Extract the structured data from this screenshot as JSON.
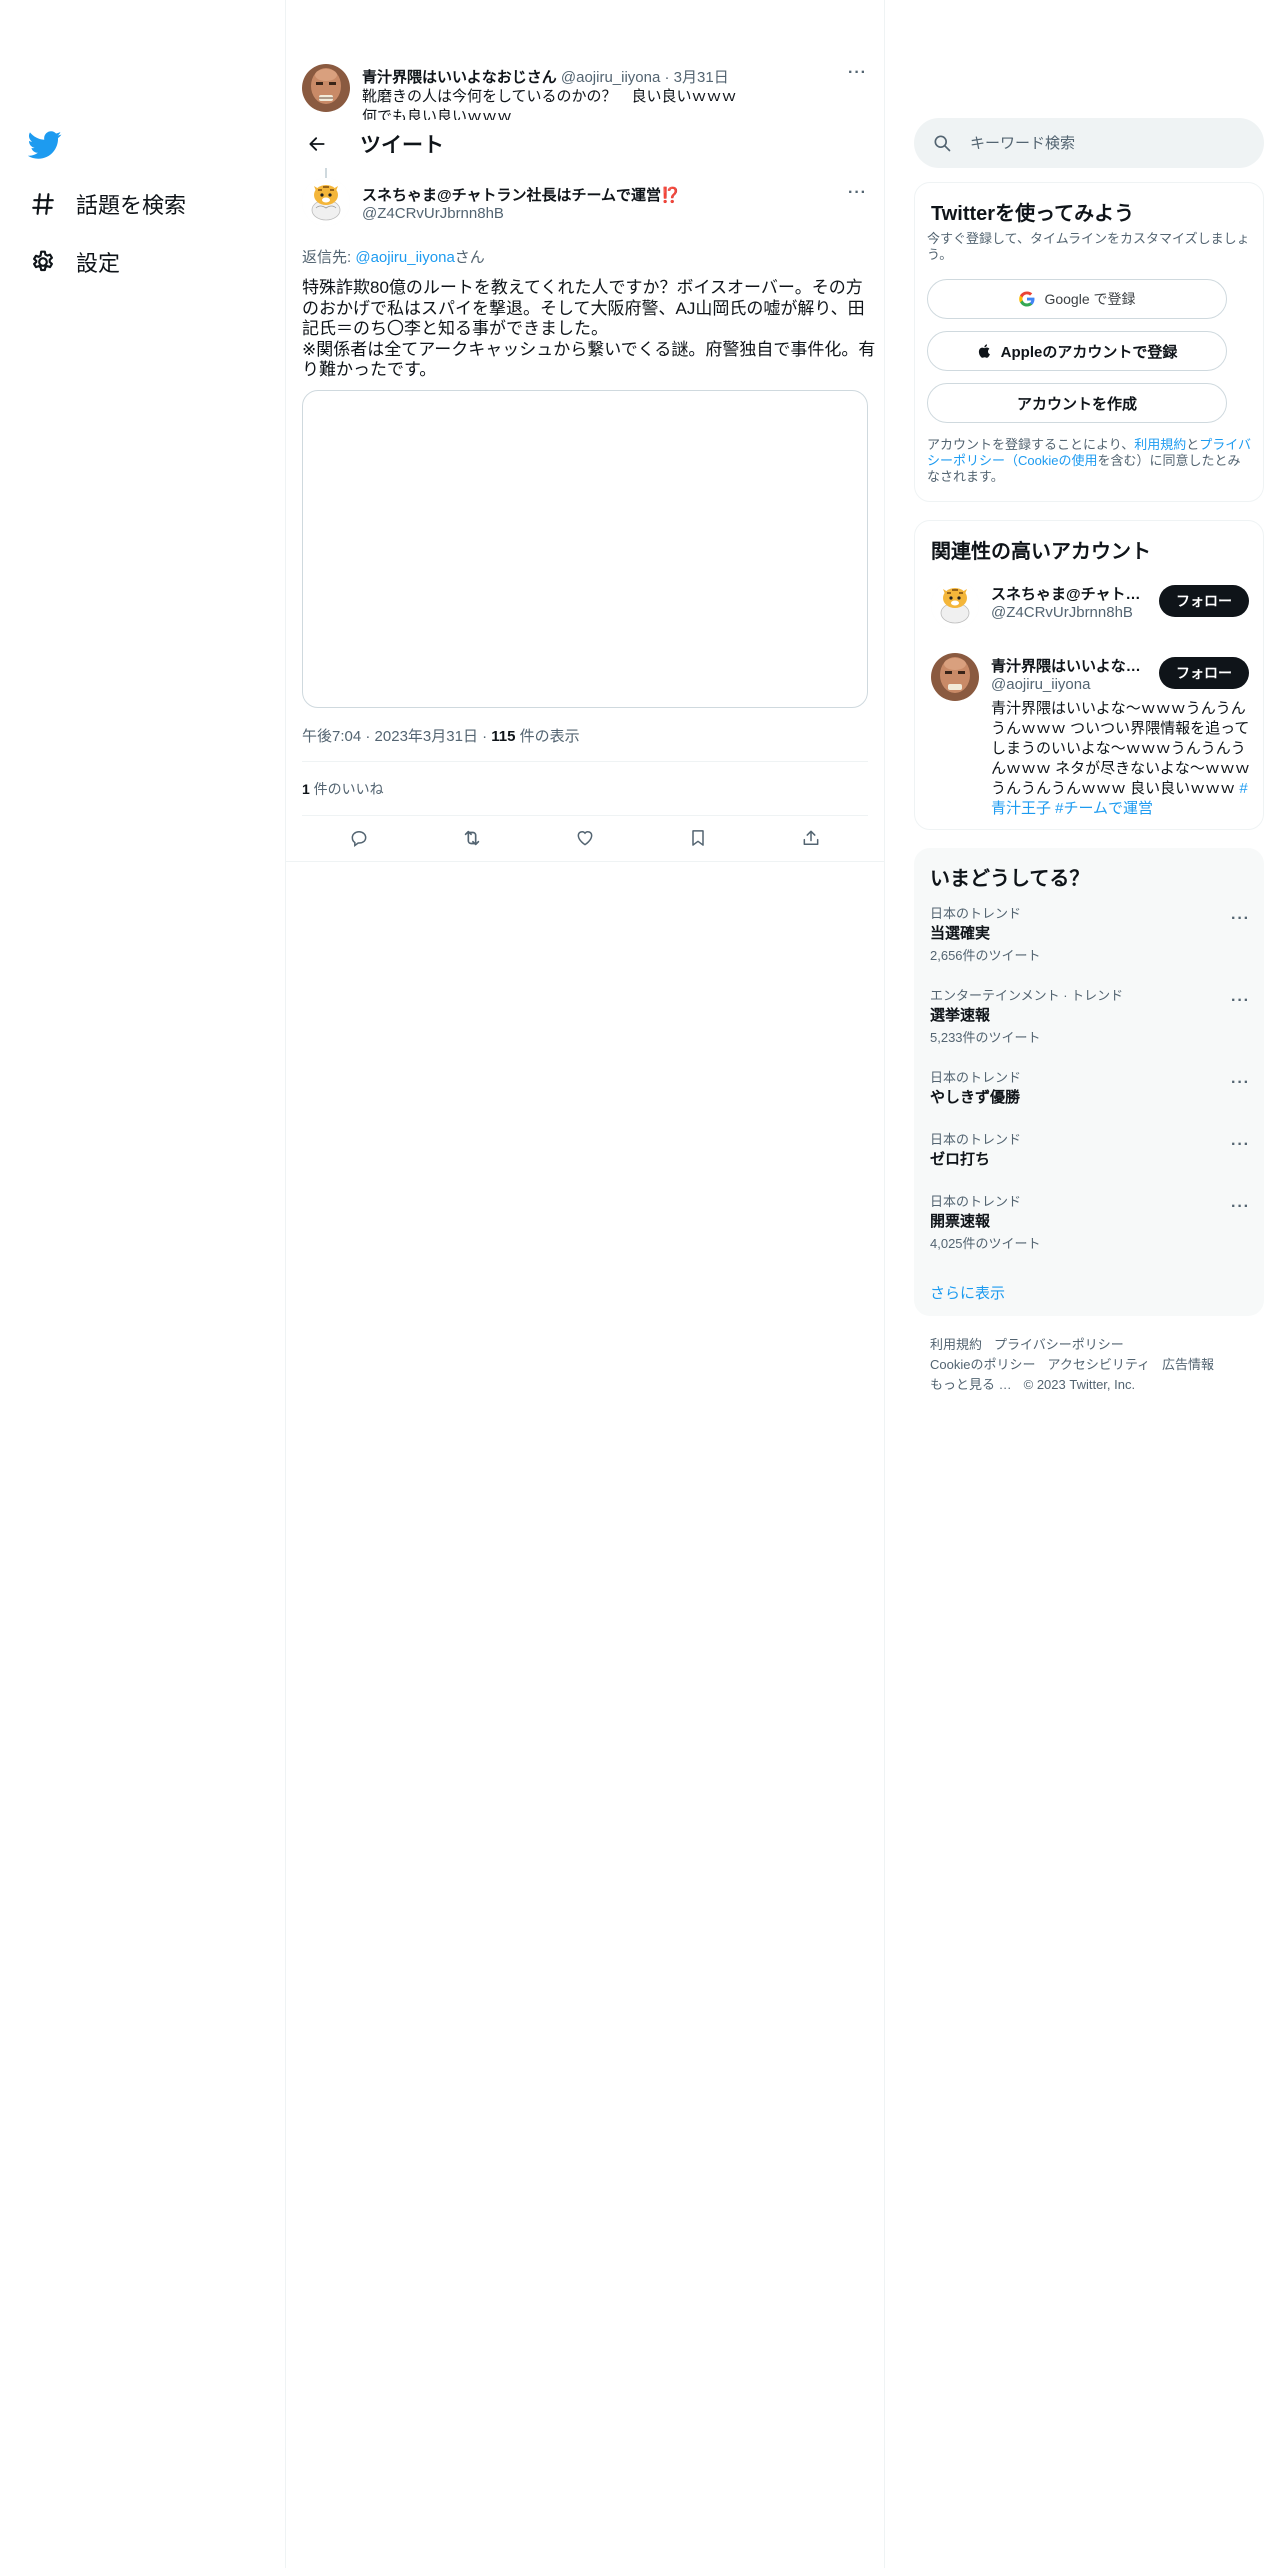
{
  "nav": {
    "logo": "twitter-bird-icon",
    "items": [
      {
        "label": "話題を検索",
        "icon": "hashtag-icon"
      },
      {
        "label": "設定",
        "icon": "gear-icon"
      }
    ]
  },
  "previous_tweet": {
    "name": "青汁界隈はいいよなおじさん",
    "handle": "@aojiru_iiyona",
    "date": "· 3月31日",
    "text": "靴磨きの人は今何をしているのかの？　良い良いｗｗｗ\n何でも良い良いｗｗｗ"
  },
  "header": {
    "title": "ツイート"
  },
  "tweet": {
    "author_name": "スネちゃま@チャトラン社長はチームで運営⁉️",
    "author_handle": "@Z4CRvUrJbrnn8hB",
    "reply_prefix": "返信先: ",
    "reply_handle": "@aojiru_iiyona",
    "reply_suffix": "さん",
    "text": "特殊詐欺80億のルートを教えてくれた人ですか？ボイスオーバー。その方のおかげで私はスパイを撃退。そして大阪府警、AJ山岡氏の嘘が解り、田記氏＝のち〇李と知る事ができました。\n※関係者は全てアークキャッシュから繋いでくる謎。府警独自で事件化。有り難かったです。",
    "time": "午後7:04",
    "date": "2023年3月31日",
    "views_count": "115",
    "views_label": " 件の表示",
    "likes_count": "1",
    "likes_label": " 件のいいね"
  },
  "sidebar": {
    "search_placeholder": "キーワード検索",
    "signup": {
      "title": "Twitterを使ってみよう",
      "subtitle": "今すぐ登録して、タイムラインをカスタマイズしましょう。",
      "google_label": "Google で登録",
      "apple_label": "Appleのアカウントで登録",
      "create_label": "アカウントを作成",
      "terms_prefix": "アカウントを登録することにより、",
      "terms_link": "利用規約",
      "terms_and": "と",
      "privacy_link": "プライバシーポリシー（Cookieの使用",
      "terms_suffix": "を含む）に同意したとみなされます。"
    },
    "related": {
      "title": "関連性の高いアカウント",
      "accounts": [
        {
          "name": "スネちゃま@チャトラン社長はチームで運営⁉️",
          "handle": "@Z4CRvUrJbrnn8hB",
          "follow": "フォロー"
        },
        {
          "name": "青汁界隈はいいよなおじさん",
          "handle": "@aojiru_iiyona",
          "follow": "フォロー",
          "bio": "青汁界隈はいいよな～ｗｗｗうんうんうんｗｗｗ ついつい界隈情報を追ってしまうのいいよな～ｗｗｗうんうんうんｗｗｗ ネタが尽きないよな～ｗｗｗうんうんうんｗｗｗ 良い良いｗｗｗ ",
          "bio_tags": "#青汁王子 #チームで運営"
        }
      ]
    },
    "trends": {
      "title": "いまどうしてる？",
      "items": [
        {
          "category": "日本のトレンド",
          "name": "当選確実",
          "count": "2,656件のツイート"
        },
        {
          "category": "エンターテインメント · トレンド",
          "name": "選挙速報",
          "count": "5,233件のツイート"
        },
        {
          "category": "日本のトレンド",
          "name": "やしきず優勝",
          "count": ""
        },
        {
          "category": "日本のトレンド",
          "name": "ゼロ打ち",
          "count": ""
        },
        {
          "category": "日本のトレンド",
          "name": "開票速報",
          "count": "4,025件のツイート"
        }
      ],
      "show_more": "さらに表示"
    },
    "footer": {
      "terms": "利用規約",
      "privacy": "プライバシーポリシー",
      "cookie": "Cookieのポリシー",
      "accessibility": "アクセシビリティ",
      "ads": "広告情報",
      "more": "もっと見る …",
      "copyright": "© 2023 Twitter, Inc."
    }
  },
  "colors": {
    "accent": "#1d9bf0",
    "text": "#0f1419",
    "muted": "#536471",
    "border": "#eff3f4"
  }
}
